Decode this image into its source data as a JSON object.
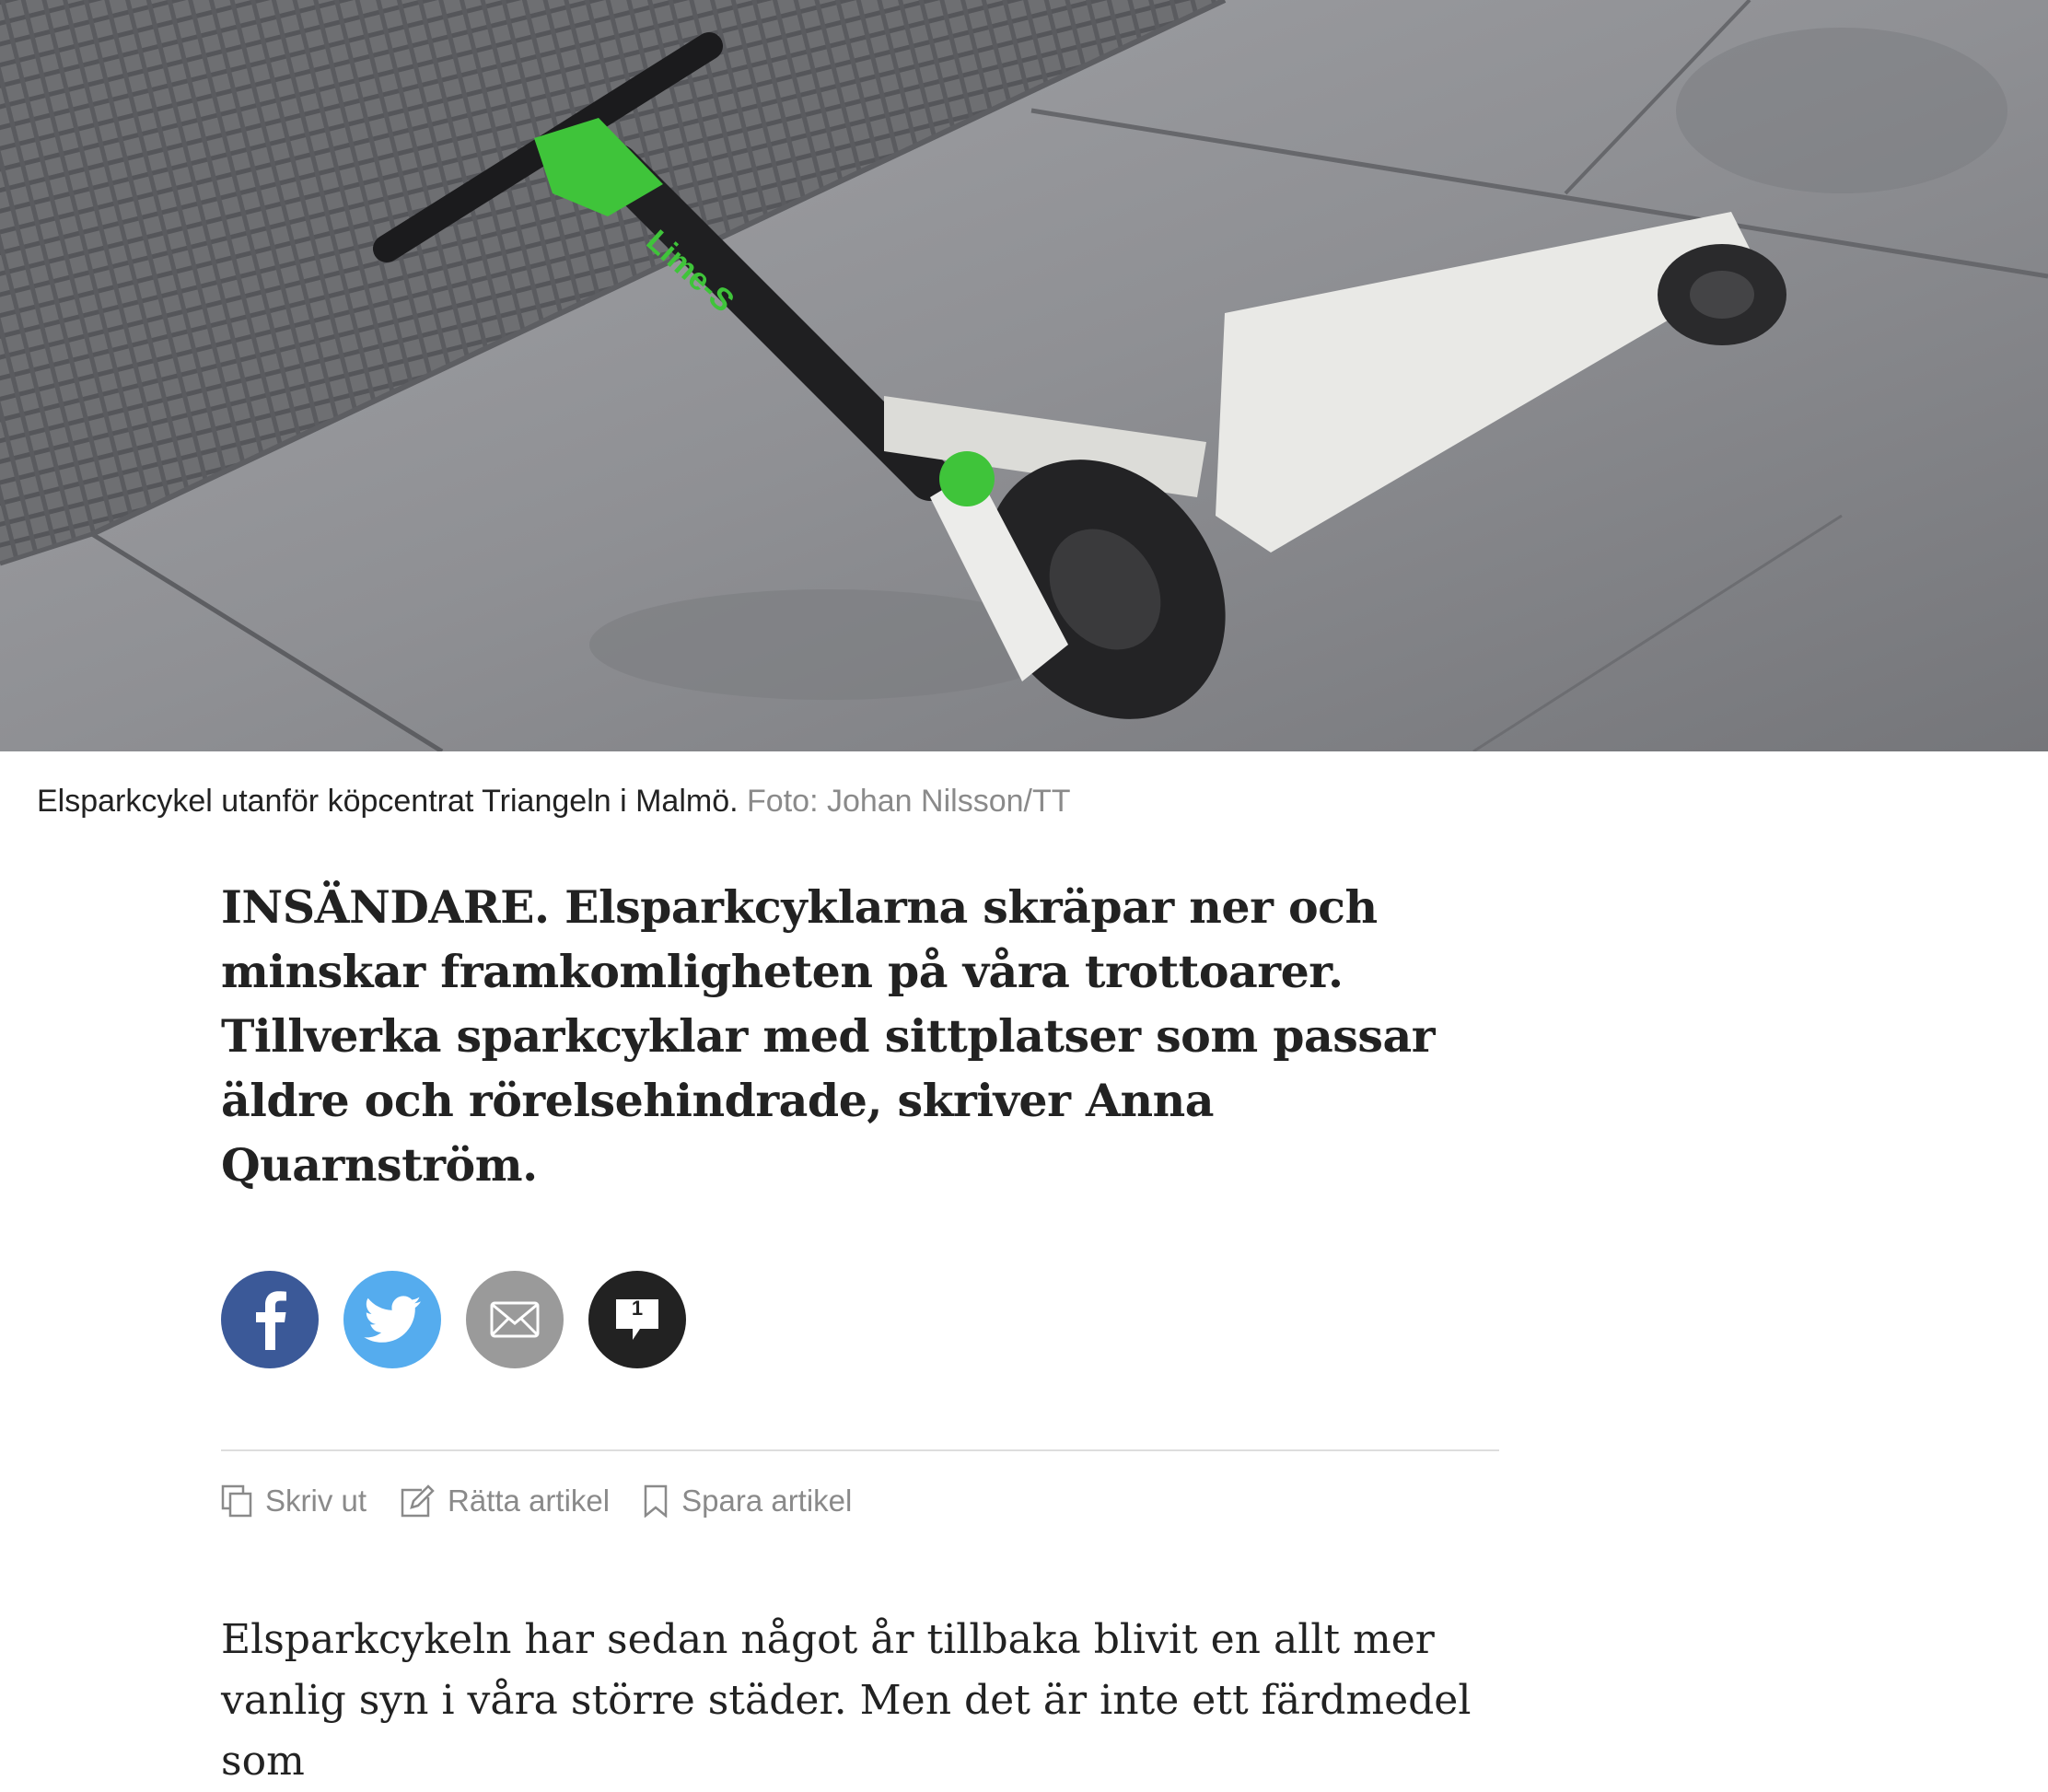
{
  "hero": {
    "alt": "Elsparkcykel på trottoar",
    "brand_text": "Lime-S"
  },
  "caption": {
    "text": "Elsparkcykel utanför köpcentrat Triangeln i Malmö.",
    "credit": "Foto: Johan Nilsson/TT"
  },
  "lead": "INSÄNDARE. Elsparkcyklarna skräpar ner och minskar framkomligheten på våra trottoarer. Tillverka sparkcyklar med sittplatser som passar äldre och rörelsehindrade, skriver Anna Quarnström.",
  "share": {
    "facebook_icon": "facebook-icon",
    "twitter_icon": "twitter-icon",
    "mail_icon": "mail-icon",
    "comment_icon": "comment-icon",
    "comment_count": "1",
    "colors": {
      "facebook": "#3b5998",
      "twitter": "#55acee",
      "mail": "#9a9a9a",
      "comment": "#222222"
    }
  },
  "tools": {
    "print_label": "Skriv ut",
    "correct_label": "Rätta artikel",
    "save_label": "Spara artikel"
  },
  "body": {
    "paragraph_1": "Elsparkcykeln har sedan något år tillbaka blivit en allt mer vanlig syn i våra större städer. Men det är inte ett färdmedel som"
  }
}
